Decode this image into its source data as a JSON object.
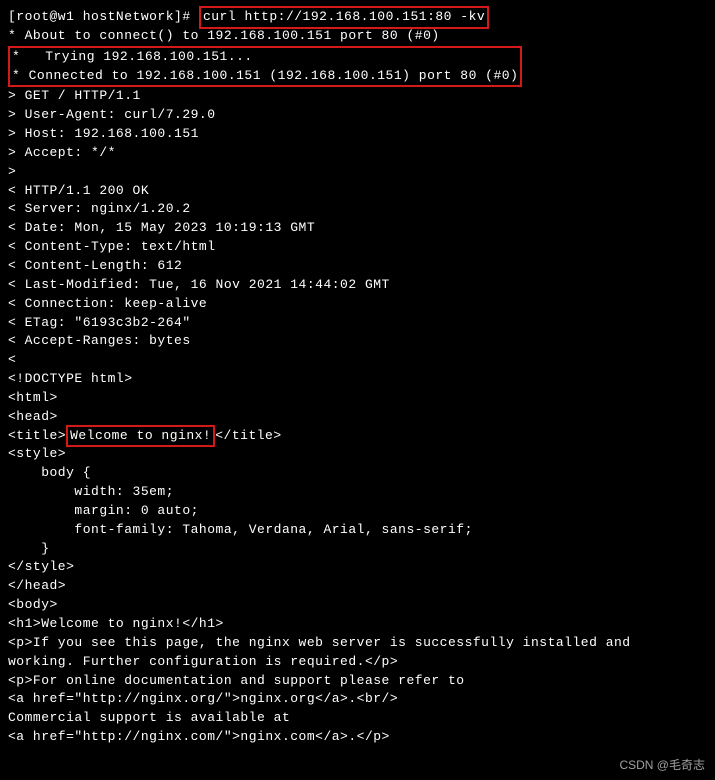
{
  "prompt": "[root@w1 hostNetwork]# ",
  "command": "curl http://192.168.100.151:80 -kv",
  "lines": {
    "l1": "* About to connect() to 192.168.100.151 port 80 (#0)",
    "l2": "*   Trying 192.168.100.151...",
    "l3": "* Connected to 192.168.100.151 (192.168.100.151) port 80 (#0)",
    "l4": "> GET / HTTP/1.1",
    "l5": "> User-Agent: curl/7.29.0",
    "l6": "> Host: 192.168.100.151",
    "l7": "> Accept: */*",
    "l8": "> ",
    "l9": "< HTTP/1.1 200 OK",
    "l10": "< Server: nginx/1.20.2",
    "l11": "< Date: Mon, 15 May 2023 10:19:13 GMT",
    "l12": "< Content-Type: text/html",
    "l13": "< Content-Length: 612",
    "l14": "< Last-Modified: Tue, 16 Nov 2021 14:44:02 GMT",
    "l15": "< Connection: keep-alive",
    "l16": "< ETag: \"6193c3b2-264\"",
    "l17": "< Accept-Ranges: bytes",
    "l18": "< ",
    "l19": "<!DOCTYPE html>",
    "l20": "<html>",
    "l21": "<head>",
    "title_open": "<title>",
    "title_text": "Welcome to nginx!",
    "title_close": "</title>",
    "l23": "<style>",
    "l24": "    body {",
    "l25": "        width: 35em;",
    "l26": "        margin: 0 auto;",
    "l27": "        font-family: Tahoma, Verdana, Arial, sans-serif;",
    "l28": "    }",
    "l29": "</style>",
    "l30": "</head>",
    "l31": "<body>",
    "l32": "<h1>Welcome to nginx!</h1>",
    "l33": "<p>If you see this page, the nginx web server is successfully installed and ",
    "l34": "working. Further configuration is required.</p>",
    "l35": "",
    "l36": "<p>For online documentation and support please refer to",
    "l37": "<a href=\"http://nginx.org/\">nginx.org</a>.<br/>",
    "l38": "Commercial support is available at",
    "l39": "<a href=\"http://nginx.com/\">nginx.com</a>.</p>"
  },
  "watermark": "CSDN @毛奇志"
}
